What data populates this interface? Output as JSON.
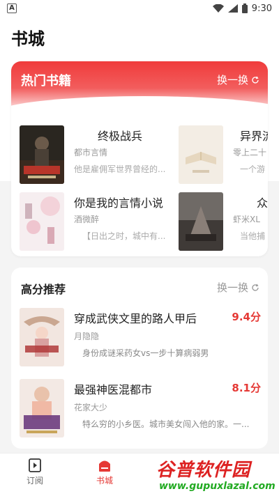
{
  "status_bar": {
    "app_icon_letter": "A",
    "time": "9:30"
  },
  "page": {
    "title": "书城"
  },
  "hot_section": {
    "title": "热门书籍",
    "refresh_label": "换一换",
    "books": [
      {
        "title": "终极战兵",
        "author": "都市言情",
        "desc": "他是雇佣军世界曾经的..."
      },
      {
        "title": "异界流",
        "author": "零上二十",
        "desc": "一个游"
      },
      {
        "title": "你是我的言情小说",
        "author": "酒微醉",
        "desc": "【日出之时，城中有..."
      },
      {
        "title": "众",
        "author": "虾米XL",
        "desc": "当他捕"
      }
    ]
  },
  "rec_section": {
    "title": "高分推荐",
    "refresh_label": "换一换",
    "items": [
      {
        "title": "穿成武侠文里的路人甲后",
        "score": "9.4分",
        "author": "月隐隐",
        "desc": "身份成谜采药女vs一步十算病弱男"
      },
      {
        "title": "最强神医混都市",
        "score": "8.1分",
        "author": "花家大少",
        "desc": "特么穷的小乡医。城市美女闯入他的家。一..."
      }
    ]
  },
  "tabbar": {
    "tabs": [
      {
        "label": "订阅"
      },
      {
        "label": "书城"
      }
    ]
  },
  "watermark": {
    "main": "谷普软件园",
    "url": "www.gupuxlazal.com"
  },
  "colors": {
    "accent": "#e53935",
    "hot_gradient_top": "#f03b3b"
  }
}
